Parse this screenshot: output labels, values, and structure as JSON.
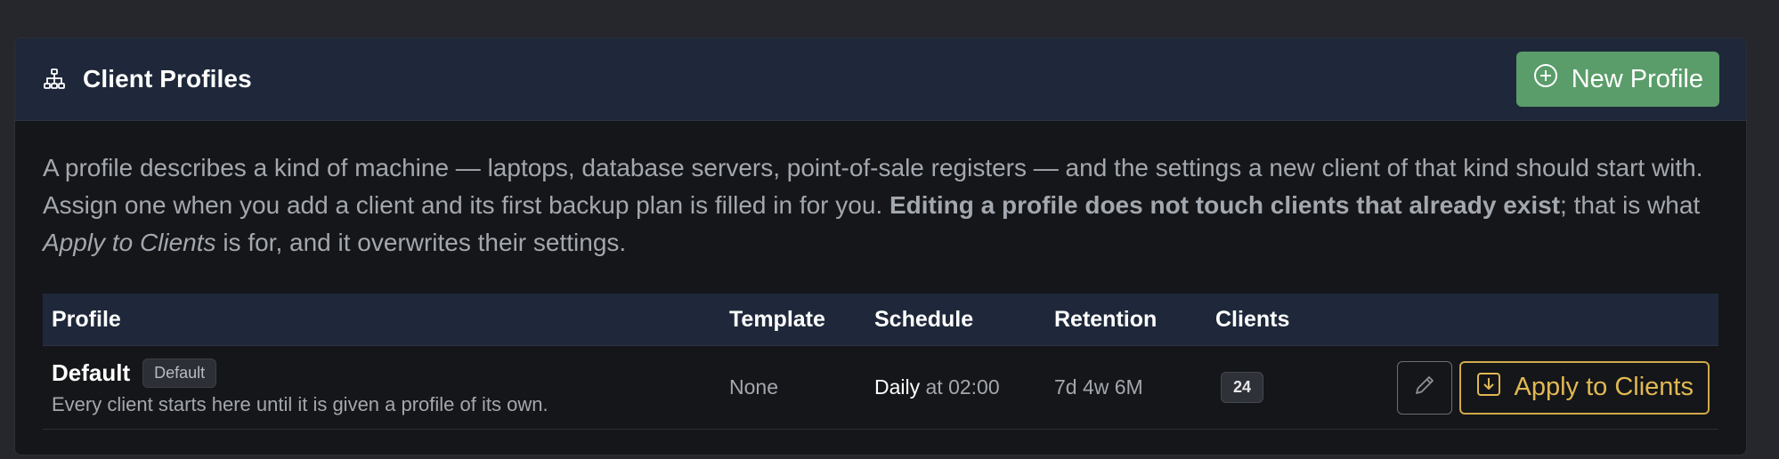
{
  "header": {
    "title": "Client Profiles",
    "icon": "sitemap-icon",
    "new_button_label": "New Profile",
    "new_button_icon": "plus-circle-icon",
    "accent_color": "#5a9d6a"
  },
  "description": {
    "part1": "A profile describes a kind of machine — laptops, database servers, point-of-sale registers — and the settings a new client of that kind should start with. Assign one when you add a client and its first backup plan is filled in for you. ",
    "bold": "Editing a profile does not touch clients that already exist",
    "part2": "; that is what ",
    "italic": "Apply to Clients",
    "part3": " is for, and it overwrites their settings."
  },
  "table": {
    "columns": [
      "Profile",
      "Template",
      "Schedule",
      "Retention",
      "Clients"
    ],
    "rows": [
      {
        "name": "Default",
        "badge": "Default",
        "description": "Every client starts here until it is given a profile of its own.",
        "template": "None",
        "schedule_freq": "Daily",
        "schedule_time": "at 02:00",
        "retention": "7d 4w 6M",
        "clients": "24",
        "edit_icon": "pencil-icon",
        "apply_label": "Apply to Clients",
        "apply_icon": "download-icon",
        "apply_color": "#e0b853"
      }
    ]
  }
}
